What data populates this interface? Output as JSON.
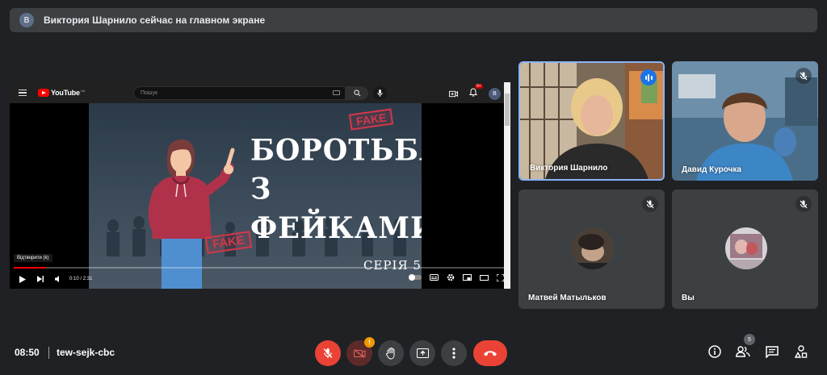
{
  "notice": {
    "avatar_letter": "В",
    "text": "Виктория Шарнило сейчас на главном экране"
  },
  "youtube": {
    "logo_text": "YouTube",
    "logo_region": "UA",
    "search_placeholder": "Пошук",
    "notification_count": "9+",
    "avatar_letter": "В",
    "video_title_line1": "БОРОТЬБА",
    "video_title_line2": "З ФЕЙКАМИ",
    "stamp_text": "FAKE",
    "series_text": "СЕРІЯ 5",
    "tooltip": "Відтворити (k)",
    "time": "0:10 / 2:31",
    "progress_fraction": 0.066
  },
  "participants": [
    {
      "name": "Виктория Шарнило",
      "speaking": true
    },
    {
      "name": "Давид Курочка",
      "muted": true
    },
    {
      "name": "Матвей Матыльков",
      "muted": true
    },
    {
      "name": "Вы",
      "muted": true
    }
  ],
  "bottom": {
    "clock": "08:50",
    "meeting_code": "tew-sejk-cbc",
    "camera_alert": "!",
    "people_count": "5"
  }
}
